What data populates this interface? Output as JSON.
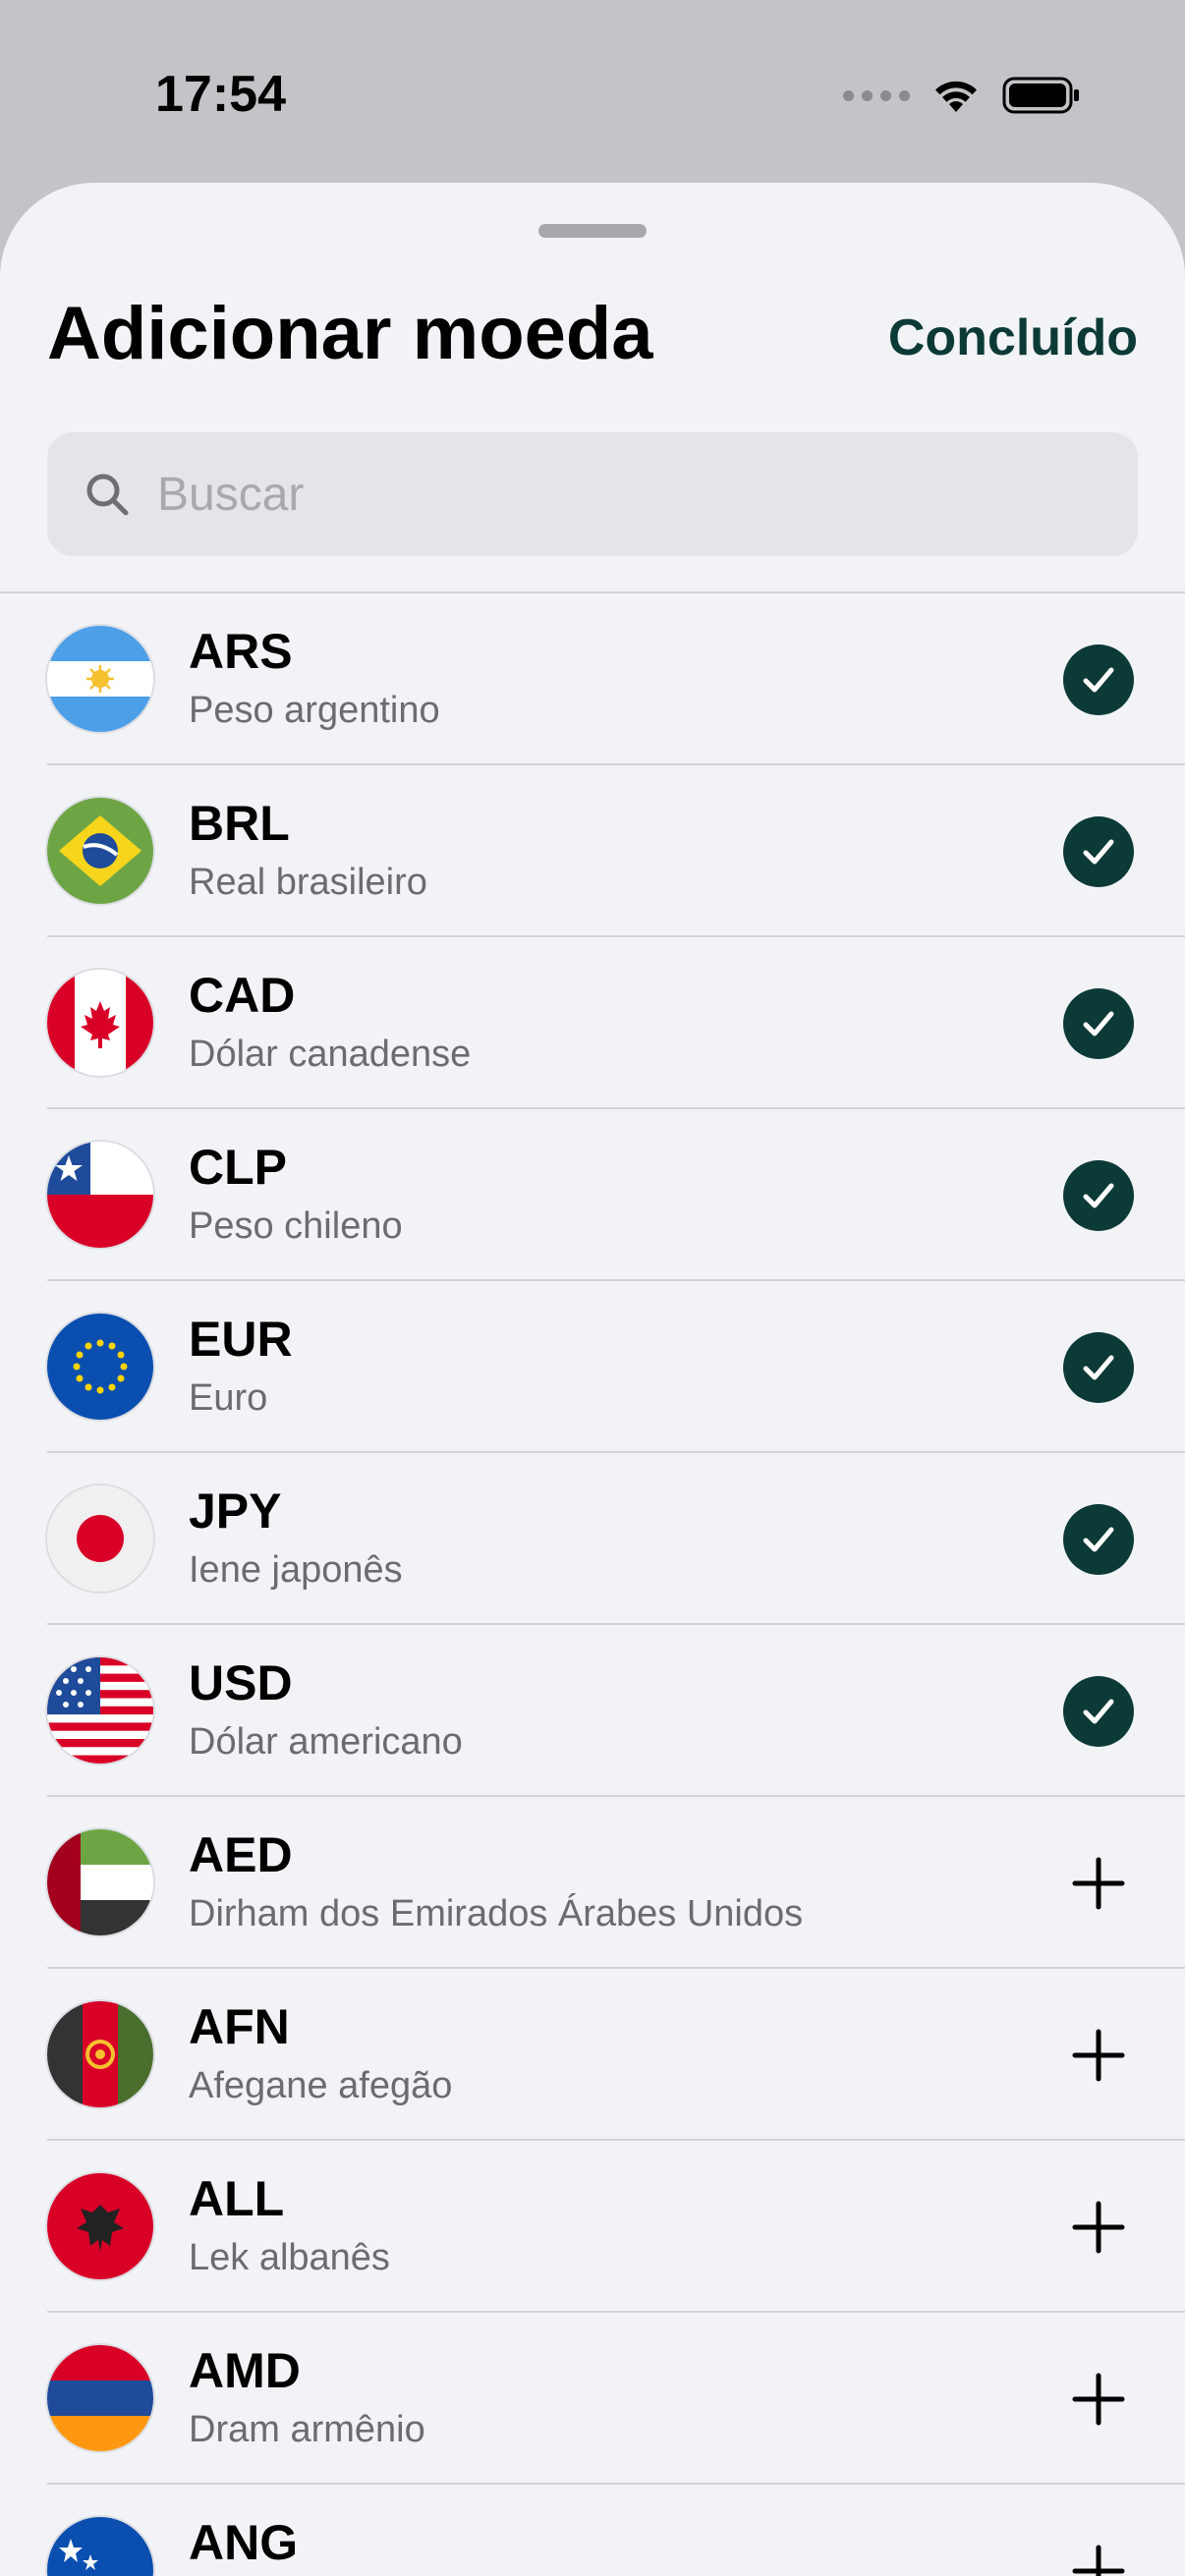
{
  "status_bar": {
    "time": "17:54"
  },
  "header": {
    "title": "Adicionar moeda",
    "done_label": "Concluído"
  },
  "search": {
    "placeholder": "Buscar"
  },
  "currencies": [
    {
      "code": "ARS",
      "name": "Peso argentino",
      "added": true,
      "flag": "argentina-flag-icon"
    },
    {
      "code": "BRL",
      "name": "Real brasileiro",
      "added": true,
      "flag": "brazil-flag-icon"
    },
    {
      "code": "CAD",
      "name": "Dólar canadense",
      "added": true,
      "flag": "canada-flag-icon"
    },
    {
      "code": "CLP",
      "name": "Peso chileno",
      "added": true,
      "flag": "chile-flag-icon"
    },
    {
      "code": "EUR",
      "name": "Euro",
      "added": true,
      "flag": "eu-flag-icon"
    },
    {
      "code": "JPY",
      "name": "Iene japonês",
      "added": true,
      "flag": "japan-flag-icon"
    },
    {
      "code": "USD",
      "name": "Dólar americano",
      "added": true,
      "flag": "usa-flag-icon"
    },
    {
      "code": "AED",
      "name": "Dirham dos Emirados Árabes Unidos",
      "added": false,
      "flag": "uae-flag-icon"
    },
    {
      "code": "AFN",
      "name": "Afegane afegão",
      "added": false,
      "flag": "afghanistan-flag-icon"
    },
    {
      "code": "ALL",
      "name": "Lek albanês",
      "added": false,
      "flag": "albania-flag-icon"
    },
    {
      "code": "AMD",
      "name": "Dram armênio",
      "added": false,
      "flag": "armenia-flag-icon"
    },
    {
      "code": "ANG",
      "name": "",
      "added": false,
      "flag": "curacao-flag-icon"
    }
  ],
  "colors": {
    "accent": "#0c3a36",
    "sheet_bg": "#f2f3f7",
    "separator": "#d2d3d8"
  }
}
